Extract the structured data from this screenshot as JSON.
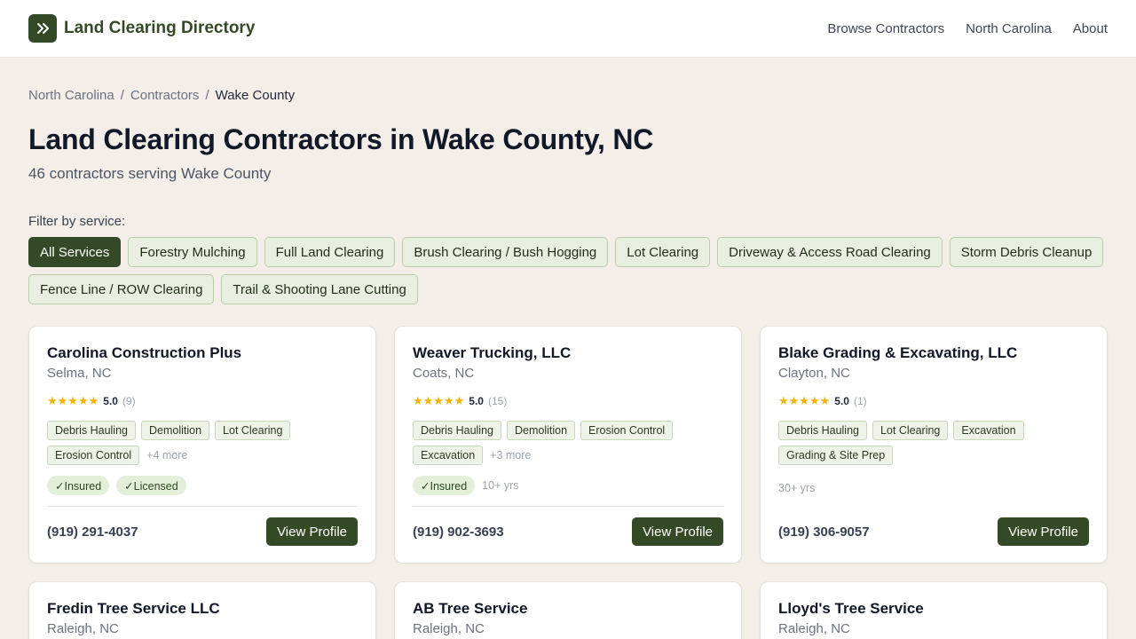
{
  "header": {
    "brand": "Land Clearing Directory",
    "nav": [
      "Browse Contractors",
      "North Carolina",
      "About"
    ]
  },
  "breadcrumb": [
    "North Carolina",
    "Contractors",
    "Wake County"
  ],
  "page": {
    "title": "Land Clearing Contractors in Wake County, NC",
    "subtitle": "46 contractors serving Wake County"
  },
  "filter": {
    "label": "Filter by service:",
    "options": [
      "All Services",
      "Forestry Mulching",
      "Full Land Clearing",
      "Brush Clearing / Bush Hogging",
      "Lot Clearing",
      "Driveway & Access Road Clearing",
      "Storm Debris Cleanup",
      "Fence Line / ROW Clearing",
      "Trail & Shooting Lane Cutting"
    ],
    "selected": "All Services"
  },
  "contractors": [
    {
      "name": "Carolina Construction Plus",
      "location": "Selma, NC",
      "stars": "★★★★★",
      "rating": "5.0",
      "reviews": "(9)",
      "services": [
        "Debris Hauling",
        "Demolition",
        "Lot Clearing",
        "Erosion Control"
      ],
      "more": "+4 more",
      "badges": [
        "✓Insured",
        "✓Licensed"
      ],
      "years": "",
      "phone": "(919) 291-4037",
      "cta": "View Profile"
    },
    {
      "name": "Weaver Trucking, LLC",
      "location": "Coats, NC",
      "stars": "★★★★★",
      "rating": "5.0",
      "reviews": "(15)",
      "services": [
        "Debris Hauling",
        "Demolition",
        "Erosion Control",
        "Excavation"
      ],
      "more": "+3 more",
      "badges": [
        "✓Insured"
      ],
      "years": "10+ yrs",
      "phone": "(919) 902-3693",
      "cta": "View Profile"
    },
    {
      "name": "Blake Grading & Excavating, LLC",
      "location": "Clayton, NC",
      "stars": "★★★★★",
      "rating": "5.0",
      "reviews": "(1)",
      "services": [
        "Debris Hauling",
        "Lot Clearing",
        "Excavation",
        "Grading & Site Prep"
      ],
      "more": "",
      "badges": [],
      "years": "30+ yrs",
      "phone": "(919) 306-9057",
      "cta": "View Profile"
    },
    {
      "name": "Fredin Tree Service LLC",
      "location": "Raleigh, NC"
    },
    {
      "name": "AB Tree Service",
      "location": "Raleigh, NC"
    },
    {
      "name": "Lloyd's Tree Service",
      "location": "Raleigh, NC"
    }
  ]
}
